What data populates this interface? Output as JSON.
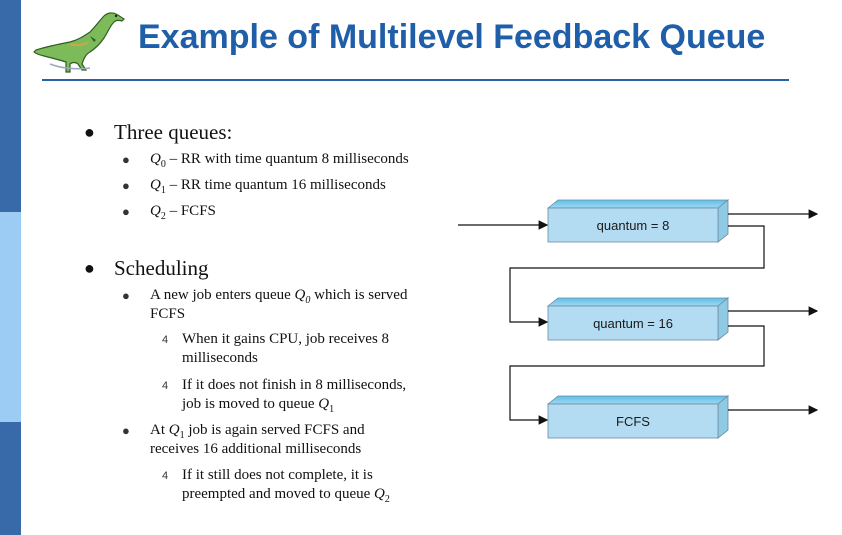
{
  "title": "Example of Multilevel Feedback Queue",
  "bullets": {
    "three_queues": "Three queues:",
    "q0": {
      "name": "Q",
      "sub": "0",
      "text": " – RR with time quantum 8 milliseconds"
    },
    "q1": {
      "name": "Q",
      "sub": "1",
      "text": " – RR time quantum 16 milliseconds"
    },
    "q2": {
      "name": "Q",
      "sub": "2",
      "text": " – FCFS"
    },
    "scheduling": "Scheduling",
    "s1_line1_a": "A new job enters queue ",
    "s1_q": "Q",
    "s1_sub": "0",
    "s1_line1_b": " which is served",
    "s1_line2": "FCFS",
    "s1a_line1": "When it gains CPU, job receives 8",
    "s1a_line2": "milliseconds",
    "s1b_line1": "If it does not finish in 8 milliseconds,",
    "s1b_line2": "job is moved to queue ",
    "s1b_q": "Q",
    "s1b_sub": "1",
    "s2_line1_a": "At ",
    "s2_q": "Q",
    "s2_sub": "1",
    "s2_line1_b": " job is again served FCFS and",
    "s2_line2": "receives 16 additional milliseconds",
    "s2a_line1": "If it still does not complete, it is",
    "s2a_line2": "preempted and moved to queue ",
    "s2a_q": "Q",
    "s2a_sub": "2",
    "sub_marker": "4"
  },
  "diagram": {
    "queues": [
      {
        "label": "quantum = 8"
      },
      {
        "label": "quantum = 16"
      },
      {
        "label": "FCFS"
      }
    ]
  },
  "icons": {
    "logo": "dinosaur-logo"
  },
  "colors": {
    "title": "#1f5ea8",
    "sidebar_dark": "#3869a8",
    "sidebar_light": "#9ccbf3",
    "queue_box": "#b3dcf2"
  }
}
